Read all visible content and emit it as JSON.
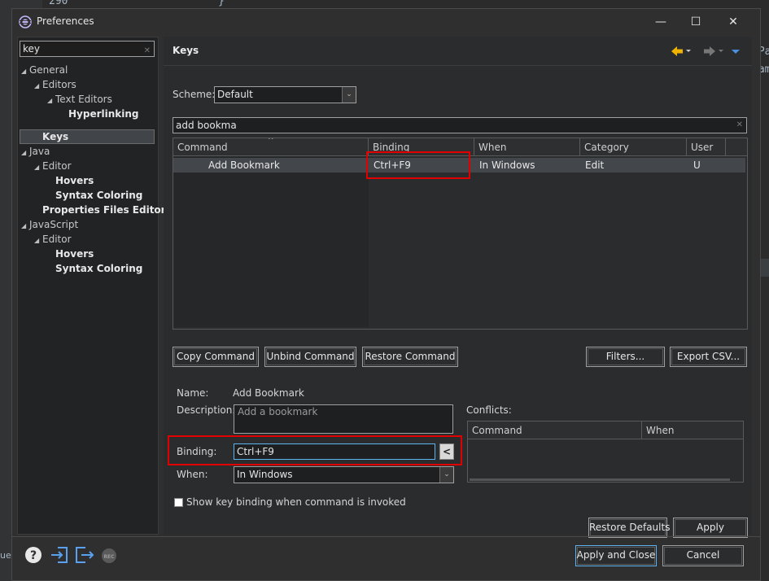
{
  "background": {
    "line_number": "290",
    "line_text": "}",
    "right_text_1": "tPa",
    "right_text_2": "Sam",
    "left_edge_text": "ues"
  },
  "window": {
    "title": "Preferences",
    "minimize": "—",
    "maximize": "☐",
    "close": "✕"
  },
  "filter": {
    "value": "key"
  },
  "tree": [
    {
      "label": "General",
      "arrow": "◢",
      "bold": false
    },
    {
      "label": "Editors",
      "arrow": "◢",
      "bold": false
    },
    {
      "label": "Text Editors",
      "arrow": "◢",
      "bold": false
    },
    {
      "label": "Hyperlinking",
      "arrow": "",
      "bold": true
    },
    {
      "label": "Keys",
      "arrow": "",
      "bold": true
    },
    {
      "label": "Java",
      "arrow": "◢",
      "bold": false
    },
    {
      "label": "Editor",
      "arrow": "◢",
      "bold": false
    },
    {
      "label": "Hovers",
      "arrow": "",
      "bold": true
    },
    {
      "label": "Syntax Coloring",
      "arrow": "",
      "bold": true
    },
    {
      "label": "Properties Files Editor",
      "arrow": "",
      "bold": true
    },
    {
      "label": "JavaScript",
      "arrow": "◢",
      "bold": false
    },
    {
      "label": "Editor",
      "arrow": "◢",
      "bold": false
    },
    {
      "label": "Hovers",
      "arrow": "",
      "bold": true
    },
    {
      "label": "Syntax Coloring",
      "arrow": "",
      "bold": true
    }
  ],
  "page": {
    "title": "Keys",
    "scheme_label": "Scheme:",
    "scheme_value": "Default",
    "search_value": "add bookma"
  },
  "table": {
    "headers": [
      "Command",
      "Binding",
      "When",
      "Category",
      "User"
    ],
    "rows": [
      {
        "command": "Add Bookmark",
        "binding": "Ctrl+F9",
        "when": "In Windows",
        "category": "Edit",
        "user": "U"
      }
    ]
  },
  "buttons": {
    "copy_command": "Copy Command",
    "unbind_command": "Unbind Command",
    "restore_command": "Restore Command",
    "filters": "Filters...",
    "export_csv": "Export CSV...",
    "restore_defaults": "Restore Defaults",
    "apply": "Apply",
    "apply_and_close": "Apply and Close",
    "cancel": "Cancel"
  },
  "details": {
    "name_label": "Name:",
    "name_value": "Add Bookmark",
    "description_label": "Description:",
    "description_value": "Add a bookmark",
    "binding_label": "Binding:",
    "binding_value": "Ctrl+F9",
    "binding_menu": "<",
    "when_label": "When:",
    "when_value": "In Windows",
    "conflicts_label": "Conflicts:",
    "conflicts_headers": [
      "Command",
      "When"
    ],
    "checkbox_label": "Show key binding when command is invoked"
  },
  "colors": {
    "highlight_red": "#e00000",
    "nav_arrow": "#e0a000",
    "bottom_icons": "#4a90e2"
  }
}
